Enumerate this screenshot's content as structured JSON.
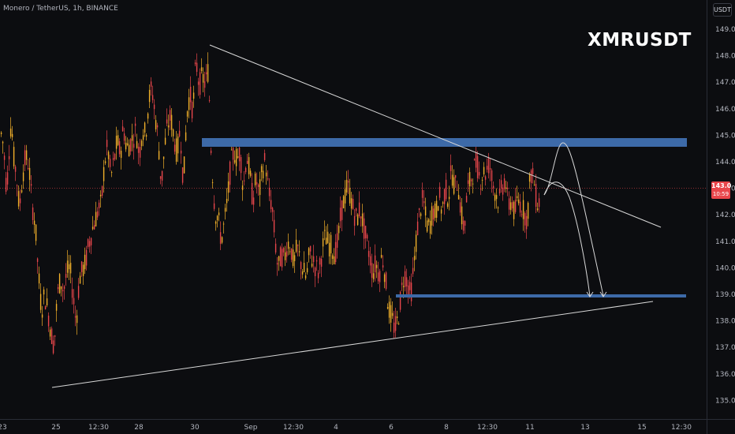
{
  "header": {
    "symbol_line": "Monero / TetherUS, 1h, BINANCE"
  },
  "currency_button": "USDT",
  "watermark": "XMRUSDT",
  "current_price": {
    "price": "143.0",
    "countdown": "10:59",
    "color": "#e8464b"
  },
  "colors": {
    "background": "#0c0d10",
    "up_candle": "#f2b12a",
    "down_candle": "#e8464b",
    "resistance_zone": "#3d6aa8",
    "trendline": "#d8d8d8"
  },
  "chart_data": {
    "type": "candlestick",
    "symbol": "XMRUSDT",
    "interval": "1h",
    "exchange": "BINANCE",
    "y_axis": {
      "ticks": [
        "149.0",
        "148.0",
        "147.0",
        "146.0",
        "145.0",
        "144.0",
        "143.0",
        "142.0",
        "141.0",
        "140.0",
        "139.0",
        "138.0",
        "137.0",
        "136.0",
        "135.0"
      ],
      "range": [
        134.8,
        149.5
      ]
    },
    "x_axis": {
      "ticks": [
        "23",
        "25",
        "12:30",
        "28",
        "30",
        "Sep",
        "12:30",
        "4",
        "6",
        "8",
        "12:30",
        "11",
        "13",
        "15",
        "12:30"
      ]
    },
    "price_path": [
      [
        0,
        145.2
      ],
      [
        4,
        144.6
      ],
      [
        8,
        142.8
      ],
      [
        10,
        144.1
      ],
      [
        14,
        145.7
      ],
      [
        16,
        144.3
      ],
      [
        20,
        143.6
      ],
      [
        24,
        142.2
      ],
      [
        28,
        143.5
      ],
      [
        32,
        144.2
      ],
      [
        36,
        143.9
      ],
      [
        40,
        142.4
      ],
      [
        44,
        141.7
      ],
      [
        48,
        139.8
      ],
      [
        52,
        138.4
      ],
      [
        56,
        139.0
      ],
      [
        60,
        138.4
      ],
      [
        64,
        137.6
      ],
      [
        68,
        137.0
      ],
      [
        72,
        138.9
      ],
      [
        76,
        139.6
      ],
      [
        80,
        139.1
      ],
      [
        84,
        139.8
      ],
      [
        88,
        140.0
      ],
      [
        92,
        139.0
      ],
      [
        96,
        137.9
      ],
      [
        100,
        139.6
      ],
      [
        104,
        139.9
      ],
      [
        108,
        140.2
      ],
      [
        112,
        140.9
      ],
      [
        116,
        141.4
      ],
      [
        120,
        141.8
      ],
      [
        124,
        142.2
      ],
      [
        128,
        142.4
      ],
      [
        132,
        144.0
      ],
      [
        136,
        144.6
      ],
      [
        140,
        143.4
      ],
      [
        144,
        144.0
      ],
      [
        148,
        144.8
      ],
      [
        152,
        144.3
      ],
      [
        156,
        145.3
      ],
      [
        160,
        144.5
      ],
      [
        164,
        144.7
      ],
      [
        168,
        144.9
      ],
      [
        172,
        145.2
      ],
      [
        176,
        144.2
      ],
      [
        180,
        145.3
      ],
      [
        184,
        145.0
      ],
      [
        188,
        146.3
      ],
      [
        192,
        146.8
      ],
      [
        196,
        145.8
      ],
      [
        200,
        144.9
      ],
      [
        204,
        143.1
      ],
      [
        208,
        144.5
      ],
      [
        212,
        145.4
      ],
      [
        216,
        145.7
      ],
      [
        220,
        144.9
      ],
      [
        224,
        144.3
      ],
      [
        228,
        145.3
      ],
      [
        232,
        143.1
      ],
      [
        236,
        145.7
      ],
      [
        240,
        146.6
      ],
      [
        244,
        145.9
      ],
      [
        248,
        147.8
      ],
      [
        252,
        146.9
      ],
      [
        256,
        147.2
      ],
      [
        260,
        146.9
      ],
      [
        264,
        147.6
      ],
      [
        266,
        145.1
      ],
      [
        268,
        144.0
      ],
      [
        272,
        142.1
      ],
      [
        276,
        141.9
      ],
      [
        280,
        141.0
      ],
      [
        284,
        141.7
      ],
      [
        288,
        142.6
      ],
      [
        292,
        143.9
      ],
      [
        296,
        144.4
      ],
      [
        300,
        144.1
      ],
      [
        304,
        144.4
      ],
      [
        308,
        142.9
      ],
      [
        312,
        144.3
      ],
      [
        316,
        143.6
      ],
      [
        320,
        142.5
      ],
      [
        324,
        143.4
      ],
      [
        328,
        142.7
      ],
      [
        332,
        143.7
      ],
      [
        336,
        144.1
      ],
      [
        340,
        142.8
      ],
      [
        344,
        142.4
      ],
      [
        348,
        141.1
      ],
      [
        352,
        139.9
      ],
      [
        356,
        140.5
      ],
      [
        360,
        140.3
      ],
      [
        364,
        141.0
      ],
      [
        368,
        140.8
      ],
      [
        372,
        140.1
      ],
      [
        376,
        140.8
      ],
      [
        380,
        140.3
      ],
      [
        384,
        139.9
      ],
      [
        388,
        139.6
      ],
      [
        392,
        140.6
      ],
      [
        396,
        140.3
      ],
      [
        400,
        140.0
      ],
      [
        404,
        139.8
      ],
      [
        408,
        140.7
      ],
      [
        412,
        141.2
      ],
      [
        416,
        140.9
      ],
      [
        420,
        140.8
      ],
      [
        424,
        140.5
      ],
      [
        428,
        141.0
      ],
      [
        432,
        142.1
      ],
      [
        436,
        142.6
      ],
      [
        440,
        143.1
      ],
      [
        444,
        142.7
      ],
      [
        448,
        142.1
      ],
      [
        452,
        141.8
      ],
      [
        456,
        142.3
      ],
      [
        460,
        141.6
      ],
      [
        464,
        141.0
      ],
      [
        468,
        140.5
      ],
      [
        472,
        139.8
      ],
      [
        476,
        140.2
      ],
      [
        480,
        139.7
      ],
      [
        484,
        140.5
      ],
      [
        488,
        139.7
      ],
      [
        492,
        138.5
      ],
      [
        496,
        138.1
      ],
      [
        500,
        137.7
      ],
      [
        504,
        138.0
      ],
      [
        508,
        139.0
      ],
      [
        512,
        139.8
      ],
      [
        516,
        139.5
      ],
      [
        520,
        138.9
      ],
      [
        524,
        140.0
      ],
      [
        528,
        141.3
      ],
      [
        532,
        142.2
      ],
      [
        536,
        142.6
      ],
      [
        540,
        141.7
      ],
      [
        544,
        141.5
      ],
      [
        548,
        142.2
      ],
      [
        552,
        142.0
      ],
      [
        556,
        142.8
      ],
      [
        560,
        142.1
      ],
      [
        564,
        143.0
      ],
      [
        568,
        142.6
      ],
      [
        572,
        143.7
      ],
      [
        576,
        143.0
      ],
      [
        580,
        143.3
      ],
      [
        584,
        142.1
      ],
      [
        588,
        141.4
      ],
      [
        592,
        142.9
      ],
      [
        596,
        143.3
      ],
      [
        600,
        143.7
      ],
      [
        604,
        144.0
      ],
      [
        608,
        143.3
      ],
      [
        612,
        143.6
      ],
      [
        616,
        143.6
      ],
      [
        620,
        144.0
      ],
      [
        624,
        143.2
      ],
      [
        628,
        142.8
      ],
      [
        632,
        142.5
      ],
      [
        636,
        143.0
      ],
      [
        640,
        143.4
      ],
      [
        644,
        142.3
      ],
      [
        648,
        142.6
      ],
      [
        652,
        142.0
      ],
      [
        656,
        142.6
      ],
      [
        660,
        142.4
      ],
      [
        664,
        142.1
      ],
      [
        668,
        141.8
      ],
      [
        672,
        143.6
      ],
      [
        676,
        143.4
      ],
      [
        680,
        142.5
      ]
    ],
    "annotations": {
      "resistance_zone": {
        "from": 144.5,
        "to": 144.8
      },
      "support_level": 139.0,
      "descending_trendline": {
        "from_price": 148.5,
        "to_price": 141.7
      },
      "ascending_trendline": {
        "from_price": 135.6,
        "to_price": 138.8
      },
      "current_price_line": 143.0,
      "projection_paths": 2
    }
  }
}
